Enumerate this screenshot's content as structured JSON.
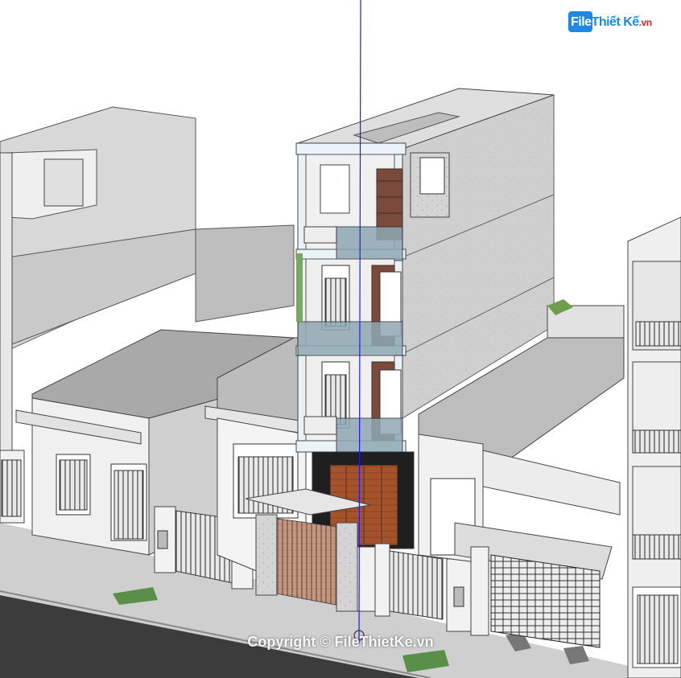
{
  "logo": {
    "brand_box": "File",
    "brand_rest": "Thiết Kế",
    "brand_tld": ".vn"
  },
  "watermark": {
    "text": "Copyright © FileThietKe.vn"
  },
  "colors": {
    "sky": "#ffffff",
    "road": "#3a3a3a",
    "sidewalk": "#bdbdbd",
    "wall_light": "#e8e8e8",
    "wall_grey": "#b5b5b5",
    "marble": "#cfcfcf",
    "wood_door": "#a0522d",
    "glass": "#8fa7b3",
    "axis_blue": "#1a1aff",
    "brand": "#1e88e5"
  }
}
